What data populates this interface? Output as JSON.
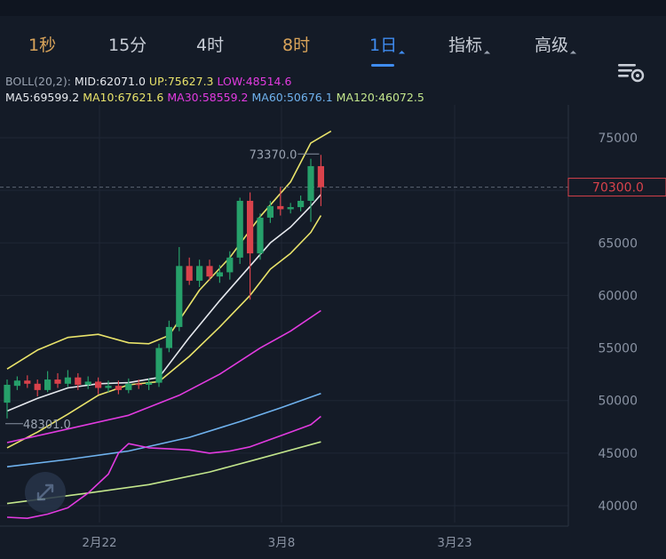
{
  "tabs": [
    {
      "label": "1秒",
      "style": "gold",
      "dropdown": false
    },
    {
      "label": "15分",
      "style": "normal",
      "dropdown": false
    },
    {
      "label": "4时",
      "style": "normal",
      "dropdown": false
    },
    {
      "label": "8时",
      "style": "gold",
      "dropdown": false
    },
    {
      "label": "1日",
      "style": "blue",
      "dropdown": true,
      "selected": true
    },
    {
      "label": "指标",
      "style": "normal",
      "dropdown": true
    },
    {
      "label": "高级",
      "style": "normal",
      "dropdown": true
    }
  ],
  "settings_icon": "chart-settings-icon",
  "legend": {
    "boll": {
      "label": "BOLL(20,2):",
      "mid": "MID:62071.0",
      "up": "UP:75627.3",
      "low": "LOW:48514.6"
    },
    "ma": {
      "ma5": "MA5:69599.2",
      "ma10": "MA10:67621.6",
      "ma30": "MA30:58559.2",
      "ma60": "MA60:50676.1",
      "ma120": "MA120:46072.5"
    }
  },
  "colors": {
    "up": "#26a06a",
    "down": "#d9424b",
    "accent": "#3f8cf0",
    "gold": "#d8a35a",
    "price_tag": "#d9424b",
    "ma5": "#e6e9ee",
    "ma10": "#e9e36a",
    "ma30": "#e23be0",
    "ma60": "#6fb2ee",
    "ma120": "#c3e68c"
  },
  "chart_data": {
    "type": "candlestick",
    "y_axis_ticks": [
      "75000",
      "70000",
      "65000",
      "60000",
      "55000",
      "50000",
      "45000",
      "40000"
    ],
    "ylim": [
      38500,
      79000
    ],
    "x_axis_labels": [
      "2月22",
      "3月8",
      "3月23"
    ],
    "current_price": "70300.0",
    "high_label": "73370.0",
    "low_label": "48301.0",
    "candles": [
      {
        "o": 49800,
        "c": 51500,
        "h": 52000,
        "l": 48301
      },
      {
        "o": 51400,
        "c": 51900,
        "h": 52300,
        "l": 51000
      },
      {
        "o": 51900,
        "c": 51600,
        "h": 52400,
        "l": 51200
      },
      {
        "o": 51600,
        "c": 51000,
        "h": 52000,
        "l": 50400
      },
      {
        "o": 51000,
        "c": 52000,
        "h": 52800,
        "l": 50800
      },
      {
        "o": 52000,
        "c": 51600,
        "h": 52600,
        "l": 51200
      },
      {
        "o": 51600,
        "c": 52200,
        "h": 52900,
        "l": 51300
      },
      {
        "o": 52200,
        "c": 51500,
        "h": 52600,
        "l": 51000
      },
      {
        "o": 51500,
        "c": 51800,
        "h": 52300,
        "l": 51100
      },
      {
        "o": 51800,
        "c": 51200,
        "h": 52200,
        "l": 50600
      },
      {
        "o": 51200,
        "c": 51400,
        "h": 51900,
        "l": 50800
      },
      {
        "o": 51400,
        "c": 51000,
        "h": 51900,
        "l": 50600
      },
      {
        "o": 51000,
        "c": 51600,
        "h": 52100,
        "l": 50700
      },
      {
        "o": 51600,
        "c": 51500,
        "h": 52000,
        "l": 51100
      },
      {
        "o": 51500,
        "c": 51700,
        "h": 52100,
        "l": 51000
      },
      {
        "o": 51700,
        "c": 55000,
        "h": 55400,
        "l": 51300
      },
      {
        "o": 55000,
        "c": 57000,
        "h": 57600,
        "l": 54600
      },
      {
        "o": 57000,
        "c": 62800,
        "h": 64600,
        "l": 56600
      },
      {
        "o": 62800,
        "c": 61400,
        "h": 63600,
        "l": 61000
      },
      {
        "o": 61400,
        "c": 62800,
        "h": 63400,
        "l": 60800
      },
      {
        "o": 62800,
        "c": 61800,
        "h": 63400,
        "l": 61400
      },
      {
        "o": 61800,
        "c": 62200,
        "h": 62900,
        "l": 61200
      },
      {
        "o": 62200,
        "c": 63600,
        "h": 64200,
        "l": 61500
      },
      {
        "o": 63600,
        "c": 69000,
        "h": 69300,
        "l": 63000
      },
      {
        "o": 69000,
        "c": 64000,
        "h": 69800,
        "l": 59600
      },
      {
        "o": 64000,
        "c": 67400,
        "h": 67800,
        "l": 63400
      },
      {
        "o": 67400,
        "c": 68500,
        "h": 69000,
        "l": 66900
      },
      {
        "o": 68500,
        "c": 68200,
        "h": 70300,
        "l": 67600
      },
      {
        "o": 68200,
        "c": 68400,
        "h": 68800,
        "l": 67800
      },
      {
        "o": 68400,
        "c": 69000,
        "h": 69500,
        "l": 68000
      },
      {
        "o": 69000,
        "c": 72300,
        "h": 73000,
        "l": 67000
      },
      {
        "o": 72300,
        "c": 70300,
        "h": 73370,
        "l": 68500
      }
    ],
    "series": [
      {
        "name": "UP",
        "color": "#e9e36a",
        "values": [
          {
            "i": 0,
            "v": 53000
          },
          {
            "i": 3,
            "v": 54800
          },
          {
            "i": 6,
            "v": 56000
          },
          {
            "i": 9,
            "v": 56300
          },
          {
            "i": 12,
            "v": 55500
          },
          {
            "i": 14,
            "v": 55400
          },
          {
            "i": 16,
            "v": 56200
          },
          {
            "i": 19,
            "v": 60500
          },
          {
            "i": 22,
            "v": 63600
          },
          {
            "i": 25,
            "v": 67500
          },
          {
            "i": 28,
            "v": 70800
          },
          {
            "i": 30,
            "v": 74500
          },
          {
            "i": 32,
            "v": 75627
          }
        ]
      },
      {
        "name": "MID",
        "color": "#e6e9ee",
        "values": [
          {
            "i": 0,
            "v": 49000
          },
          {
            "i": 3,
            "v": 50200
          },
          {
            "i": 6,
            "v": 51200
          },
          {
            "i": 9,
            "v": 51600
          },
          {
            "i": 12,
            "v": 51700
          },
          {
            "i": 15,
            "v": 52200
          },
          {
            "i": 18,
            "v": 56000
          },
          {
            "i": 21,
            "v": 59500
          },
          {
            "i": 24,
            "v": 62800
          },
          {
            "i": 26,
            "v": 65000
          },
          {
            "i": 28,
            "v": 66500
          },
          {
            "i": 30,
            "v": 68500
          },
          {
            "i": 31,
            "v": 69600
          }
        ]
      },
      {
        "name": "LOW",
        "color": "#e9e36a",
        "values": [
          {
            "i": 0,
            "v": 45500
          },
          {
            "i": 3,
            "v": 47000
          },
          {
            "i": 6,
            "v": 48700
          },
          {
            "i": 9,
            "v": 50500
          },
          {
            "i": 12,
            "v": 51500
          },
          {
            "i": 15,
            "v": 51800
          },
          {
            "i": 18,
            "v": 54200
          },
          {
            "i": 21,
            "v": 57000
          },
          {
            "i": 24,
            "v": 60000
          },
          {
            "i": 26,
            "v": 62500
          },
          {
            "i": 28,
            "v": 64000
          },
          {
            "i": 30,
            "v": 66000
          },
          {
            "i": 31,
            "v": 67600
          }
        ]
      },
      {
        "name": "MA30",
        "color": "#e23be0",
        "values": [
          {
            "i": 0,
            "v": 46000
          },
          {
            "i": 6,
            "v": 47300
          },
          {
            "i": 12,
            "v": 48600
          },
          {
            "i": 17,
            "v": 50500
          },
          {
            "i": 21,
            "v": 52500
          },
          {
            "i": 25,
            "v": 55000
          },
          {
            "i": 28,
            "v": 56600
          },
          {
            "i": 31,
            "v": 58559
          }
        ]
      },
      {
        "name": "MA60",
        "color": "#6fb2ee",
        "values": [
          {
            "i": 0,
            "v": 43700
          },
          {
            "i": 6,
            "v": 44400
          },
          {
            "i": 12,
            "v": 45200
          },
          {
            "i": 18,
            "v": 46500
          },
          {
            "i": 23,
            "v": 48000
          },
          {
            "i": 27,
            "v": 49300
          },
          {
            "i": 31,
            "v": 50676
          }
        ]
      },
      {
        "name": "MA120",
        "color": "#c3e68c",
        "values": [
          {
            "i": 0,
            "v": 40200
          },
          {
            "i": 8,
            "v": 41200
          },
          {
            "i": 14,
            "v": 42000
          },
          {
            "i": 20,
            "v": 43200
          },
          {
            "i": 25,
            "v": 44500
          },
          {
            "i": 31,
            "v": 46072
          }
        ]
      },
      {
        "name": "pink-lower",
        "color": "#e23be0",
        "values": [
          {
            "i": 0,
            "v": 38900
          },
          {
            "i": 2,
            "v": 38800
          },
          {
            "i": 4,
            "v": 39200
          },
          {
            "i": 6,
            "v": 39800
          },
          {
            "i": 8,
            "v": 41200
          },
          {
            "i": 10,
            "v": 43000
          },
          {
            "i": 11,
            "v": 45000
          },
          {
            "i": 12,
            "v": 45900
          },
          {
            "i": 14,
            "v": 45500
          },
          {
            "i": 16,
            "v": 45400
          },
          {
            "i": 18,
            "v": 45300
          },
          {
            "i": 20,
            "v": 45000
          },
          {
            "i": 22,
            "v": 45200
          },
          {
            "i": 24,
            "v": 45600
          },
          {
            "i": 26,
            "v": 46300
          },
          {
            "i": 28,
            "v": 47000
          },
          {
            "i": 30,
            "v": 47700
          },
          {
            "i": 31,
            "v": 48500
          }
        ]
      }
    ]
  }
}
